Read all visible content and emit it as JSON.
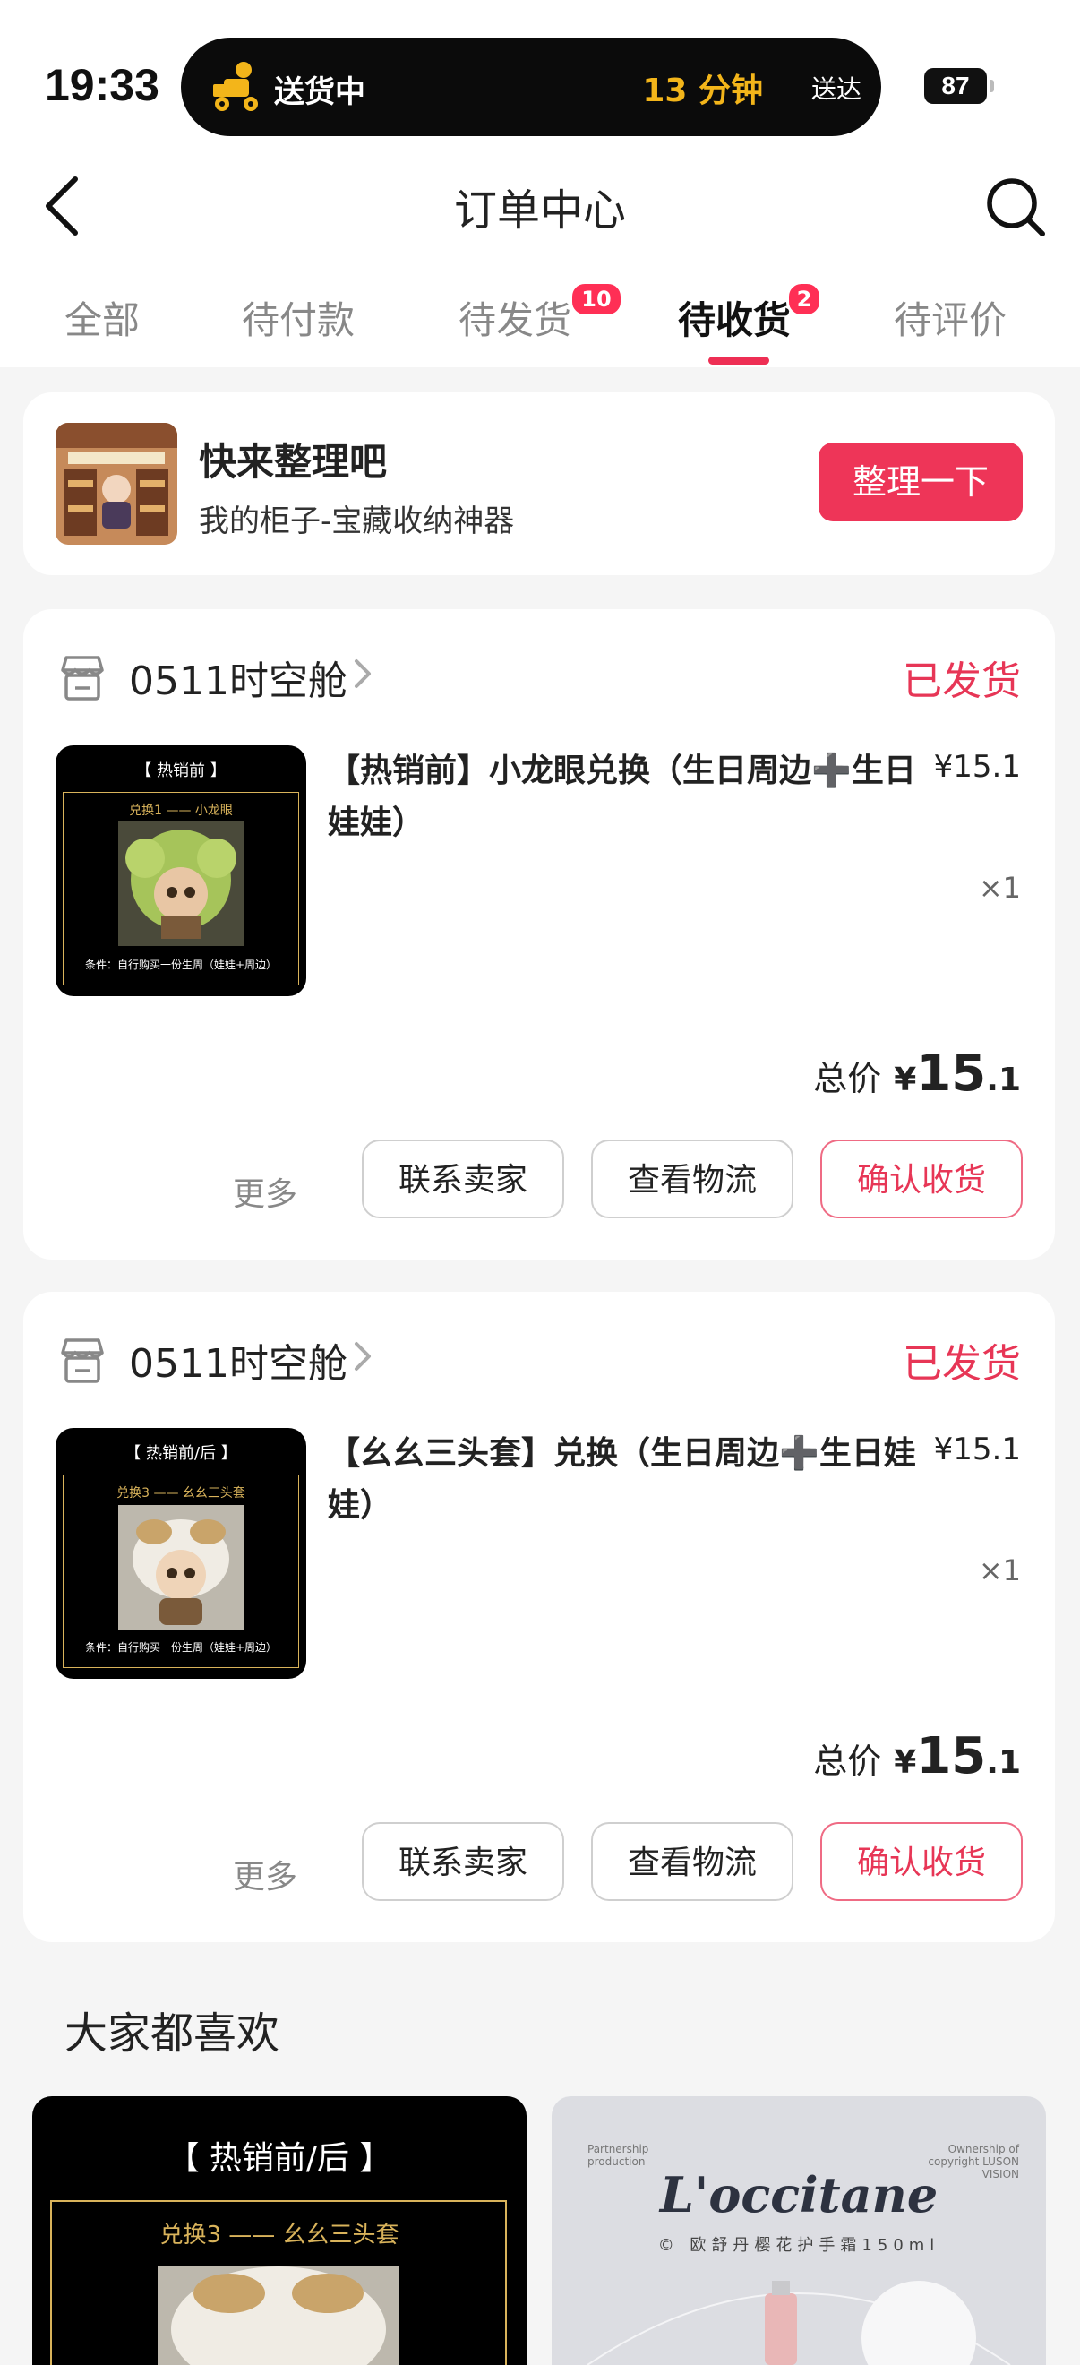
{
  "status_bar": {
    "time": "19:33",
    "delivery_text": "送货中",
    "eta_minutes": "13 分钟",
    "eta_suffix": "送达",
    "battery": "87"
  },
  "header": {
    "title": "订单中心"
  },
  "tabs": [
    {
      "label": "全部"
    },
    {
      "label": "待付款"
    },
    {
      "label": "待发货",
      "badge": "10"
    },
    {
      "label": "待收货",
      "badge": "2",
      "active": true
    },
    {
      "label": "待评价"
    }
  ],
  "promo": {
    "title": "快来整理吧",
    "subtitle": "我的柜子-宝藏收纳神器",
    "button": "整理一下"
  },
  "orders": [
    {
      "shop": "0511时空舱",
      "status": "已发货",
      "image": {
        "header": "【  热销前  】",
        "line": "兑换1  —— 小龙眼",
        "footer": "条件：自行购买一份生周（娃娃+周边）"
      },
      "title": "【热销前】小龙眼兑换（生日周边➕生日娃娃）",
      "price": "¥15.1",
      "qty": "×1",
      "total_label": "总价",
      "total_yen": "¥",
      "total_int": "15",
      "total_dec": ".1",
      "actions": {
        "more": "更多",
        "contact": "联系卖家",
        "logistics": "查看物流",
        "confirm": "确认收货"
      }
    },
    {
      "shop": "0511时空舱",
      "status": "已发货",
      "image": {
        "header": "【  热销前/后  】",
        "line": "兑换3  —— 幺幺三头套",
        "footer": "条件：自行购买一份生周（娃娃+周边）"
      },
      "title": "【幺幺三头套】兑换（生日周边➕生日娃娃）",
      "price": "¥15.1",
      "qty": "×1",
      "total_label": "总价",
      "total_yen": "¥",
      "total_int": "15",
      "total_dec": ".1",
      "actions": {
        "more": "更多",
        "contact": "联系卖家",
        "logistics": "查看物流",
        "confirm": "确认收货"
      }
    }
  ],
  "recommend": {
    "title": "大家都喜欢",
    "items": [
      {
        "header": "【   热销前/后   】",
        "line": "兑换3  —— 幺幺三头套"
      },
      {
        "brand": "L'occitane",
        "sub": "© 欧舒丹樱花护手霜150ml",
        "corner_left": "Partnership production",
        "corner_right": "Ownership of copyright LUSON VISION"
      }
    ]
  },
  "colors": {
    "accent": "#ee3558",
    "status_red": "#e73656",
    "eta_yellow": "#f3b51a"
  }
}
